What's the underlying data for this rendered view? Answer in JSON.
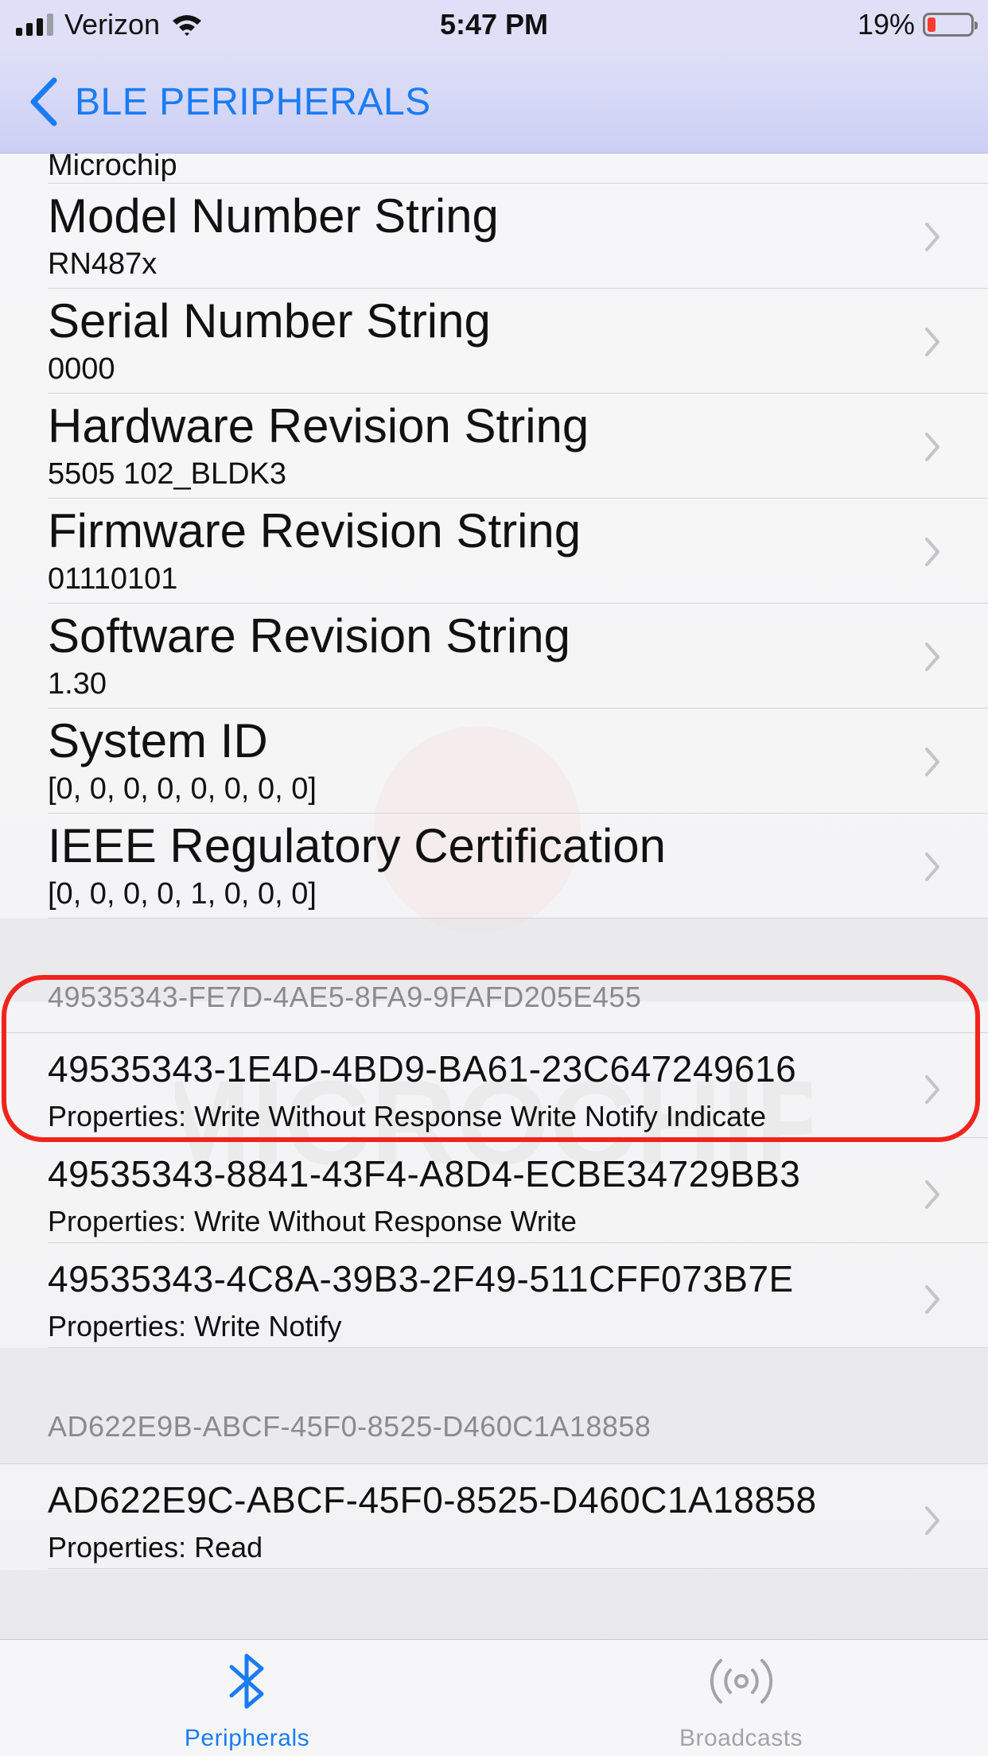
{
  "status_bar": {
    "carrier": "Verizon",
    "time": "5:47 PM",
    "battery_percent_label": "19%",
    "battery_level": 0.19,
    "signal_bars_active": 3,
    "signal_bars_total": 4
  },
  "nav": {
    "back_label": "BLE PERIPHERALS"
  },
  "device_info": {
    "partial_value": "Microchip",
    "items": [
      {
        "title": "Model Number String",
        "value": "RN487x"
      },
      {
        "title": "Serial Number String",
        "value": "0000"
      },
      {
        "title": "Hardware Revision String",
        "value": "5505 102_BLDK3"
      },
      {
        "title": "Firmware Revision String",
        "value": "01110101"
      },
      {
        "title": "Software Revision String",
        "value": "1.30"
      },
      {
        "title": "System ID",
        "value": "[0, 0, 0, 0, 0, 0, 0, 0]"
      },
      {
        "title": "IEEE Regulatory Certification",
        "value": "[0, 0, 0, 0, 1, 0, 0, 0]"
      }
    ]
  },
  "services": [
    {
      "uuid": "49535343-FE7D-4AE5-8FA9-9FAFD205E455",
      "characteristics": [
        {
          "uuid": "49535343-1E4D-4BD9-BA61-23C647249616",
          "properties": "Properties: Write Without Response Write Notify Indicate",
          "highlighted": true
        },
        {
          "uuid": "49535343-8841-43F4-A8D4-ECBE34729BB3",
          "properties": "Properties: Write Without Response Write",
          "highlighted": false
        },
        {
          "uuid": "49535343-4C8A-39B3-2F49-511CFF073B7E",
          "properties": "Properties: Write Notify",
          "highlighted": false
        }
      ]
    },
    {
      "uuid": "AD622E9B-ABCF-45F0-8525-D460C1A18858",
      "characteristics": [
        {
          "uuid": "AD622E9C-ABCF-45F0-8525-D460C1A18858",
          "properties": "Properties: Read",
          "highlighted": false
        }
      ]
    }
  ],
  "watermark_text": "MICROCHIP",
  "tab_bar": {
    "tabs": [
      {
        "label": "Peripherals",
        "icon": "bluetooth-icon",
        "active": true
      },
      {
        "label": "Broadcasts",
        "icon": "broadcast-icon",
        "active": false
      }
    ]
  },
  "colors": {
    "accent": "#1a7cf5",
    "highlight": "#f0241d",
    "inactive_tab": "#a3a3a8",
    "battery_low": "#ff3b30"
  }
}
